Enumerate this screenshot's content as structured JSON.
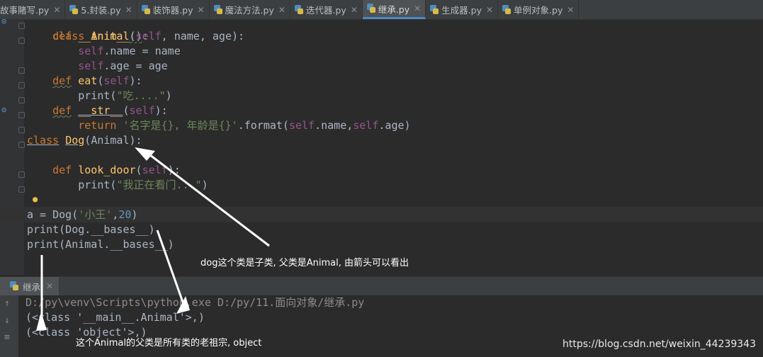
{
  "tabs": [
    {
      "label": "故事賭写.py"
    },
    {
      "label": "5.封装.py"
    },
    {
      "label": "装饰器.py"
    },
    {
      "label": "魔法方法.py"
    },
    {
      "label": "迭代器.py"
    },
    {
      "label": "继承.py",
      "active": true
    },
    {
      "label": "生成器.py"
    },
    {
      "label": "单例对象.py"
    }
  ],
  "code": {
    "l1_class": "class",
    "l1_name": "Animal",
    "l1_paren": "()",
    "l1_colon": ":",
    "l2_def": "def",
    "l2_fn": "__init__",
    "l2_open": "(",
    "l2_self": "self",
    "l2_rest": ", name, age):",
    "l3_self": "self",
    "l3_rest": ".name = name",
    "l4_self": "self",
    "l4_rest": ".age = age",
    "l5_def": "def",
    "l5_fn": "eat",
    "l5_open": "(",
    "l5_self": "self",
    "l5_close": "):",
    "l6_print": "print(",
    "l6_str": "\"吃....\"",
    "l6_close": ")",
    "l7_def": "def",
    "l7_fn": "__str__",
    "l7_open": "(",
    "l7_self": "self",
    "l7_close": "):",
    "l8_return": "return",
    "l8_str": "'名字是{}, 年龄是{}'",
    "l8_fmt": ".format(",
    "l8_self1": "self",
    "l8_name": ".name,",
    "l8_self2": "self",
    "l8_age": ".age)",
    "l9_class": "class",
    "l9_name": "Dog",
    "l9_open": "(",
    "l9_base": "Animal",
    "l9_close": "):",
    "l11_def": "def",
    "l11_fn": "look_door",
    "l11_open": "(",
    "l11_self": "self",
    "l11_close": "):",
    "l12_print": "print(",
    "l12_str": "\"我正在看门...\"",
    "l12_close": ")",
    "l14_a": "a = Dog(",
    "l14_str": "'小王'",
    "l14_comma": ",",
    "l14_num": "20",
    "l14_close": ")",
    "l15": "print(Dog.__bases__)",
    "l16": "print(Animal.__bases__)"
  },
  "run": {
    "tab_label": "继承",
    "cmd": "D:/py\\venv\\Scripts\\python.exe D:/py/11.面向对象/继承.py",
    "out1": "(<class '__main__.Animal'>,)",
    "out2": "(<class 'object'>,)"
  },
  "annotations": {
    "a1": "dog这个类是子类, 父类是Animal, 由箭头可以看出",
    "a2": "这个Animal的父类是所有类的老祖宗, object"
  },
  "watermark": "https://blog.csdn.net/weixin_44239343"
}
